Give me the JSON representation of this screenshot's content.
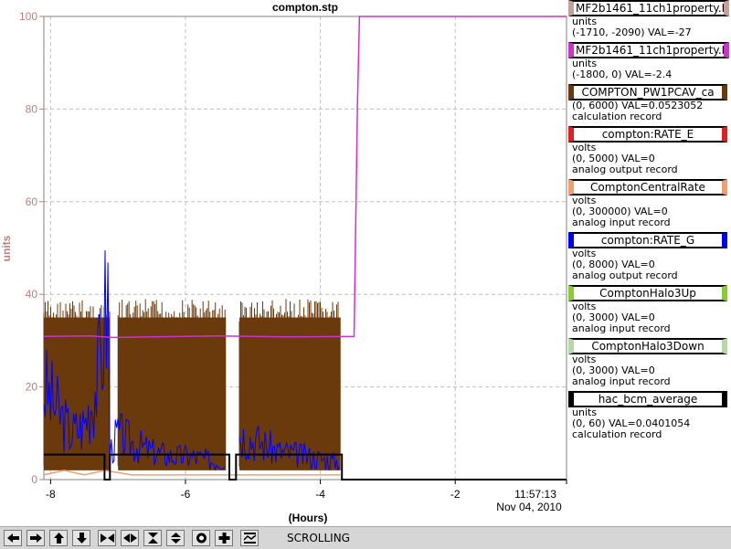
{
  "chart_data": {
    "type": "line",
    "title": "compton.stp",
    "xlabel": "(Hours)",
    "ylabel": "units",
    "xlim": [
      -8.1,
      -0.35
    ],
    "ylim": [
      0,
      100
    ],
    "x_ticks": [
      -8,
      -6,
      -4,
      -2
    ],
    "y_ticks": [
      0,
      20,
      40,
      60,
      80,
      100
    ],
    "end_time": "11:57:13",
    "end_date": "Nov 04, 2010",
    "grid": true,
    "legend_position": "right",
    "series": [
      {
        "name": "COMPTON_PW1PCAV_ca",
        "color": "#6b3a0c",
        "style": "dense-band",
        "segments": [
          [
            -8.1,
            -7.12
          ],
          [
            -7.0,
            -5.4
          ],
          [
            -5.2,
            -3.7
          ]
        ],
        "low": 2,
        "high": 39,
        "after": 0
      },
      {
        "name": "compton:RATE_G",
        "color": "#0000ff",
        "style": "noisy",
        "points": [
          [
            -8.1,
            20
          ],
          [
            -7.9,
            15
          ],
          [
            -7.7,
            10
          ],
          [
            -7.5,
            12
          ],
          [
            -7.3,
            22
          ],
          [
            -7.15,
            40
          ],
          [
            -7.12,
            6
          ],
          [
            -7.0,
            10
          ],
          [
            -6.8,
            8
          ],
          [
            -6.5,
            6
          ],
          [
            -6.2,
            5
          ],
          [
            -5.9,
            5
          ],
          [
            -5.6,
            4
          ],
          [
            -5.4,
            4
          ],
          [
            -5.2,
            10
          ],
          [
            -4.9,
            8
          ],
          [
            -4.6,
            6
          ],
          [
            -4.2,
            5
          ],
          [
            -3.8,
            4
          ],
          [
            -3.7,
            4
          ]
        ]
      },
      {
        "name": "ComptonCentralRate",
        "color": "#f0a070",
        "style": "low",
        "points": [
          [
            -8.1,
            1
          ],
          [
            -7.8,
            2
          ],
          [
            -7.5,
            1
          ],
          [
            -7.2,
            2
          ],
          [
            -6.8,
            1
          ],
          [
            -6.2,
            1
          ],
          [
            -5.6,
            1
          ],
          [
            -5.0,
            1
          ],
          [
            -4.4,
            1
          ],
          [
            -3.7,
            1
          ]
        ]
      },
      {
        "name": "hac_bcm_average",
        "color": "#000000",
        "style": "step",
        "points": [
          [
            -8.1,
            5.4
          ],
          [
            -7.2,
            5.4
          ],
          [
            -7.2,
            0
          ],
          [
            -7.12,
            0
          ],
          [
            -7.12,
            5.4
          ],
          [
            -5.35,
            5.4
          ],
          [
            -5.35,
            0
          ],
          [
            -5.25,
            0
          ],
          [
            -5.25,
            5.4
          ],
          [
            -3.68,
            5.4
          ],
          [
            -3.68,
            0
          ],
          [
            -0.35,
            0
          ]
        ]
      },
      {
        "name": "MF2b1461_11ch1property.E",
        "color": "#cc33cc",
        "style": "line",
        "points": [
          [
            -8.1,
            30.9
          ],
          [
            -7.4,
            31.0
          ],
          [
            -7.1,
            30.7
          ],
          [
            -6.5,
            30.8
          ],
          [
            -5.5,
            31.0
          ],
          [
            -4.5,
            30.8
          ],
          [
            -3.5,
            30.9
          ],
          [
            -3.45,
            81
          ],
          [
            -3.42,
            100
          ],
          [
            -0.35,
            100
          ]
        ]
      }
    ]
  },
  "legend": [
    {
      "name": "MF2b1461_11ch1property.F",
      "color": "#c8a09a",
      "lines": [
        "units",
        "(-1710, -2090) VAL=-27"
      ],
      "align": "left"
    },
    {
      "name": "MF2b1461_11ch1property.E",
      "color": "#cc33cc",
      "lines": [
        "units",
        "(-1800, 0) VAL=-2.4"
      ],
      "align": "left"
    },
    {
      "name": "COMPTON_PW1PCAV_ca",
      "color": "#6b3a0c",
      "lines": [
        "(0, 6000) VAL=0.0523052",
        "calculation record"
      ],
      "align": "center"
    },
    {
      "name": "compton:RATE_E",
      "color": "#e02020",
      "lines": [
        "volts",
        "(0, 5000) VAL=0",
        "analog output record"
      ],
      "align": "center"
    },
    {
      "name": "ComptonCentralRate",
      "color": "#f0a070",
      "lines": [
        "volts",
        "(0, 300000) VAL=0",
        "analog input record"
      ],
      "align": "center"
    },
    {
      "name": "compton:RATE_G",
      "color": "#0000ff",
      "lines": [
        "volts",
        "(0, 8000) VAL=0",
        "analog output record"
      ],
      "align": "center"
    },
    {
      "name": "ComptonHalo3Up",
      "color": "#88cc33",
      "lines": [
        "volts",
        "(0, 3000) VAL=0",
        "analog input record"
      ],
      "align": "center"
    },
    {
      "name": "ComptonHalo3Down",
      "color": "#b8d8a8",
      "lines": [
        "volts",
        "(0, 3000) VAL=0",
        "analog input record"
      ],
      "align": "center"
    },
    {
      "name": "hac_bcm_average",
      "color": "#000000",
      "lines": [
        "units",
        "(0, 60) VAL=0.0401054",
        "calculation record"
      ],
      "align": "center"
    }
  ],
  "toolbar": {
    "buttons": [
      {
        "name": "scroll-left-button",
        "icon": "arrow-left-icon"
      },
      {
        "name": "scroll-right-button",
        "icon": "arrow-right-icon"
      },
      {
        "name": "scroll-up-button",
        "icon": "arrow-up-icon"
      },
      {
        "name": "scroll-down-button",
        "icon": "arrow-down-icon"
      },
      {
        "name": "zoom-in-x-button",
        "icon": "zoom-in-horizontal-icon"
      },
      {
        "name": "zoom-out-x-button",
        "icon": "zoom-out-horizontal-icon"
      },
      {
        "name": "zoom-in-y-button",
        "icon": "zoom-in-vertical-icon"
      },
      {
        "name": "zoom-out-y-button",
        "icon": "zoom-out-vertical-icon"
      },
      {
        "name": "reset-button",
        "icon": "target-icon"
      },
      {
        "name": "add-button",
        "icon": "plus-icon"
      },
      {
        "name": "scroll-mode-button",
        "icon": "scroll-mode-icon"
      }
    ],
    "mode_label": "SCROLLING"
  }
}
